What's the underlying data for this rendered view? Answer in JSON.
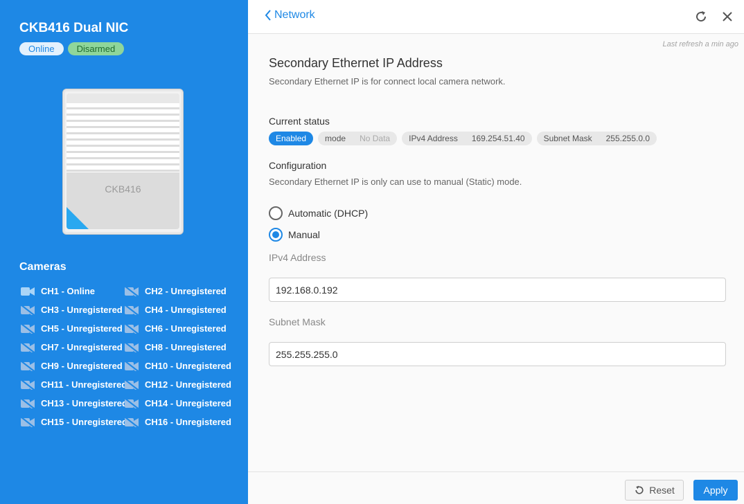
{
  "device": {
    "title": "CKB416 Dual NIC",
    "badges": {
      "online": "Online",
      "disarmed": "Disarmed"
    },
    "image_label": "CKB416"
  },
  "cameras": {
    "title": "Cameras",
    "items": [
      {
        "label": "CH1 - Online",
        "icon": "camera-online-icon"
      },
      {
        "label": "CH2 - Unregistered",
        "icon": "camera-off-icon"
      },
      {
        "label": "CH3 - Unregistered",
        "icon": "camera-off-icon"
      },
      {
        "label": "CH4 - Unregistered",
        "icon": "camera-off-icon"
      },
      {
        "label": "CH5 - Unregistered",
        "icon": "camera-off-icon"
      },
      {
        "label": "CH6 - Unregistered",
        "icon": "camera-off-icon"
      },
      {
        "label": "CH7 - Unregistered",
        "icon": "camera-off-icon"
      },
      {
        "label": "CH8 - Unregistered",
        "icon": "camera-off-icon"
      },
      {
        "label": "CH9 - Unregistered",
        "icon": "camera-off-icon"
      },
      {
        "label": "CH10 - Unregistered",
        "icon": "camera-off-icon"
      },
      {
        "label": "CH11 - Unregistered",
        "icon": "camera-off-icon"
      },
      {
        "label": "CH12 - Unregistered",
        "icon": "camera-off-icon"
      },
      {
        "label": "CH13 - Unregistered",
        "icon": "camera-off-icon"
      },
      {
        "label": "CH14 - Unregistered",
        "icon": "camera-off-icon"
      },
      {
        "label": "CH15 - Unregistered",
        "icon": "camera-off-icon"
      },
      {
        "label": "CH16 - Unregistered",
        "icon": "camera-off-icon"
      }
    ]
  },
  "header": {
    "back_label": "Network",
    "last_refresh": "Last refresh a min ago"
  },
  "section": {
    "title": "Secondary Ethernet IP Address",
    "description": "Secondary Ethernet IP is for connect local camera network."
  },
  "status": {
    "label": "Current status",
    "enabled": "Enabled",
    "mode_key": "mode",
    "mode_value": "No Data",
    "ipv4_key": "IPv4 Address",
    "ipv4_value": "169.254.51.40",
    "mask_key": "Subnet Mask",
    "mask_value": "255.255.0.0"
  },
  "configuration": {
    "label": "Configuration",
    "description": "Secondary Ethernet IP is only can use to manual (Static) mode.",
    "options": {
      "dhcp": "Automatic (DHCP)",
      "manual": "Manual"
    },
    "selected": "manual",
    "ipv4_label": "IPv4 Address",
    "ipv4_value": "192.168.0.192",
    "mask_label": "Subnet Mask",
    "mask_value": "255.255.255.0"
  },
  "footer": {
    "reset_label": "Reset",
    "apply_label": "Apply"
  },
  "colors": {
    "accent": "#1e88e5",
    "disarmed_badge": "#8fd69a"
  }
}
